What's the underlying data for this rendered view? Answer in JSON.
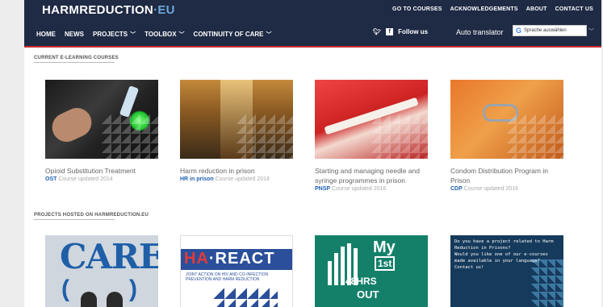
{
  "header": {
    "logo_main": "HARMREDUCTION",
    "logo_suffix": "·EU",
    "top_links": [
      "GO TO COURSES",
      "ACKNOWLEDGEMENTS",
      "ABOUT",
      "CONTACT US"
    ],
    "nav": [
      {
        "label": "HOME",
        "active": true,
        "dropdown": false
      },
      {
        "label": "NEWS",
        "active": false,
        "dropdown": false
      },
      {
        "label": "PROJECTS",
        "active": false,
        "dropdown": true
      },
      {
        "label": "TOOLBOX",
        "active": false,
        "dropdown": true
      },
      {
        "label": "CONTINUITY OF CARE",
        "active": false,
        "dropdown": true
      }
    ],
    "follow_label": "Follow us",
    "translate_label": "Auto translator",
    "translate_select": "Sprache auswählen",
    "icons": [
      "twitter-icon",
      "facebook-icon",
      "google-icon",
      "chevron-down-icon"
    ]
  },
  "courses_section": {
    "title": "CURRENT E-LEARNING COURSES",
    "items": [
      {
        "title": "Opioid Substitution Treatment",
        "code": "OST",
        "updated": "Course updated 2014"
      },
      {
        "title": "Harm reduction in prison",
        "code": "HR in prison",
        "updated": "Course updated 2014"
      },
      {
        "title": "Starting and managing needle and syringe programmes in prison",
        "code": "PNSP",
        "updated": "Course updated 2016"
      },
      {
        "title": "Condom Distribution Program in Prison",
        "code": "CDP",
        "updated": "Course updated 2016"
      }
    ]
  },
  "projects_section": {
    "title": "PROJECTS HOSTED ON HARMREDUCTION.EU",
    "care_logo": "CARE",
    "hareact_logo_a": "HA",
    "hareact_logo_b": "·REACT",
    "hareact_sub": "JOINT ACTION ON HIV AND CO-INFECTION PREVENTION AND HARM REDUCTION",
    "my1st_my": "My",
    "my1st_first": "1st",
    "my1st_hrs": "48HRS",
    "my1st_out": "OUT",
    "cta_text": "Do you have a project related to Harm Reduction in Prisons?\nWould you like one of our e-courses made available in your language?\nContact us!"
  },
  "colors": {
    "header_bg": "#1f2a44",
    "accent_red": "#c72b2e",
    "link_blue": "#1f5fb0"
  }
}
